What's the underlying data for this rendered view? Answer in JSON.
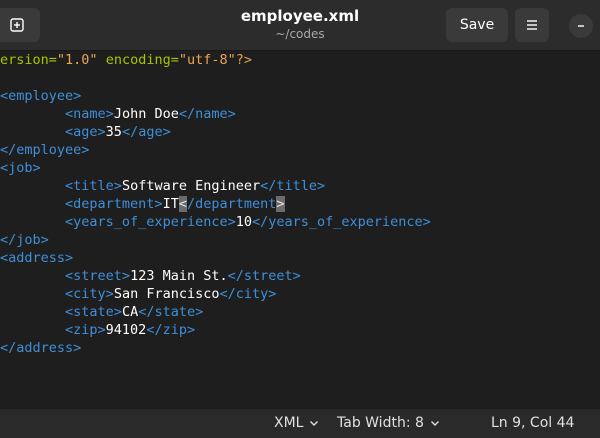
{
  "window": {
    "title": "employee.xml",
    "subtitle": "~/codes",
    "save_label": "Save"
  },
  "icons": {
    "new_tab": "new-tab-icon",
    "menu": "hamburger-menu-icon",
    "close": "close-window-icon",
    "chevron": "chevron-down-icon"
  },
  "statusbar": {
    "language": "XML",
    "tab_width": "Tab Width: 8",
    "cursor_position": "Ln 9, Col 44"
  },
  "editor": {
    "lines": [
      [
        [
          "attr",
          "ersion="
        ],
        [
          "str",
          "\"1.0\""
        ],
        [
          "txt",
          " "
        ],
        [
          "attr",
          "encoding="
        ],
        [
          "str",
          "\"utf-8\""
        ],
        [
          "pi",
          "?>"
        ]
      ],
      [],
      [
        [
          "tag",
          "<employee>"
        ]
      ],
      [
        [
          "txt",
          "        "
        ],
        [
          "tag",
          "<name>"
        ],
        [
          "txt",
          "John Doe"
        ],
        [
          "tag",
          "</name>"
        ]
      ],
      [
        [
          "txt",
          "        "
        ],
        [
          "tag",
          "<age>"
        ],
        [
          "txt",
          "35"
        ],
        [
          "tag",
          "</age>"
        ]
      ],
      [
        [
          "tag",
          "</employee>"
        ]
      ],
      [
        [
          "tag",
          "<job>"
        ]
      ],
      [
        [
          "txt",
          "        "
        ],
        [
          "tag",
          "<title>"
        ],
        [
          "txt",
          "Software Engineer"
        ],
        [
          "tag",
          "</title>"
        ]
      ],
      [
        [
          "txt",
          "        "
        ],
        [
          "tag",
          "<department>"
        ],
        [
          "txt",
          "IT"
        ],
        [
          "cursor",
          "<"
        ],
        [
          "tag",
          "/department"
        ],
        [
          "cursor",
          ">"
        ]
      ],
      [
        [
          "txt",
          "        "
        ],
        [
          "tag",
          "<years_of_experience>"
        ],
        [
          "txt",
          "10"
        ],
        [
          "tag",
          "</years_of_experience>"
        ]
      ],
      [
        [
          "tag",
          "</job>"
        ]
      ],
      [
        [
          "tag",
          "<address>"
        ]
      ],
      [
        [
          "txt",
          "        "
        ],
        [
          "tag",
          "<street>"
        ],
        [
          "txt",
          "123 Main St."
        ],
        [
          "tag",
          "</street>"
        ]
      ],
      [
        [
          "txt",
          "        "
        ],
        [
          "tag",
          "<city>"
        ],
        [
          "txt",
          "San Francisco"
        ],
        [
          "tag",
          "</city>"
        ]
      ],
      [
        [
          "txt",
          "        "
        ],
        [
          "tag",
          "<state>"
        ],
        [
          "txt",
          "CA"
        ],
        [
          "tag",
          "</state>"
        ]
      ],
      [
        [
          "txt",
          "        "
        ],
        [
          "tag",
          "<zip>"
        ],
        [
          "txt",
          "94102"
        ],
        [
          "tag",
          "</zip>"
        ]
      ],
      [
        [
          "tag",
          "</address>"
        ]
      ]
    ]
  }
}
